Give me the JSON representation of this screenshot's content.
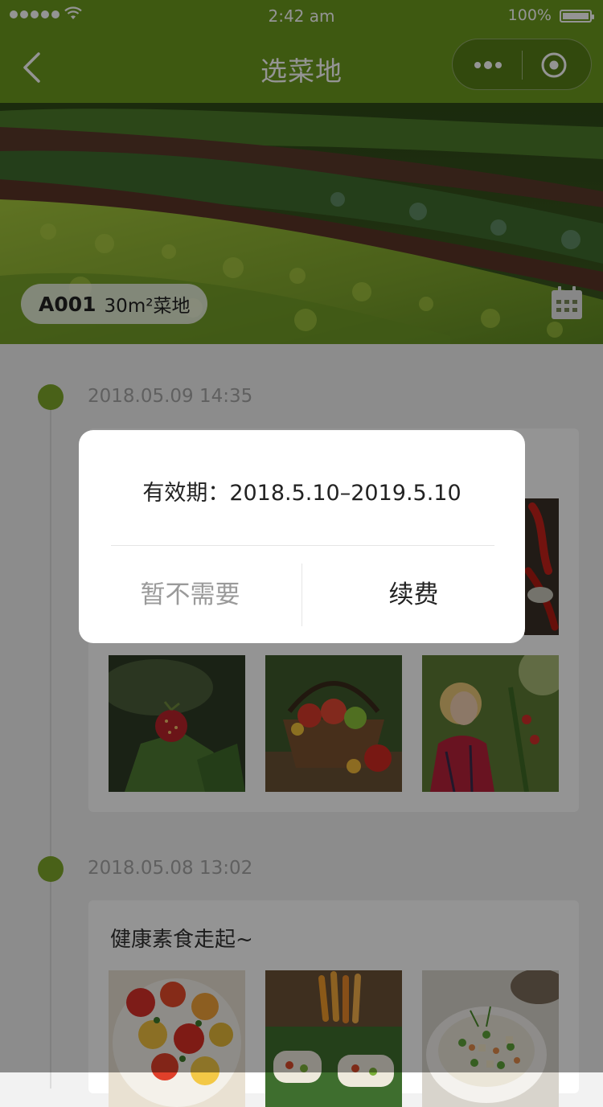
{
  "status_bar": {
    "time": "2:42 am",
    "battery_percent": "100%"
  },
  "nav": {
    "title": "选菜地"
  },
  "plot": {
    "code": "A001",
    "area": "30m²菜地"
  },
  "timeline": [
    {
      "date": "2018.05.09 14:35"
    },
    {
      "date": "2018.05.08 13:02",
      "text": "健康素食走起~"
    }
  ],
  "modal": {
    "validity": "有效期：2018.5.10–2019.5.10",
    "cancel_label": "暂不需要",
    "renew_label": "续费"
  }
}
